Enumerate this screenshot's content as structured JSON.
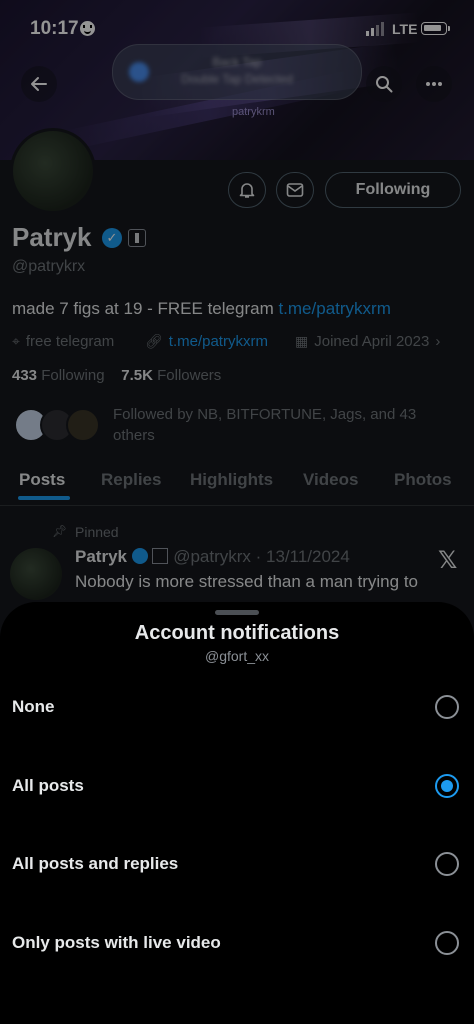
{
  "status_bar": {
    "time": "10:17",
    "network": "LTE"
  },
  "top_bar": {
    "back_icon": "arrow-left-icon",
    "notification_pill": {
      "line1": "Back Tap",
      "line2": "Double Tap Detected"
    },
    "search_icon": "search-icon",
    "more_icon": "more-horizontal-icon"
  },
  "profile": {
    "banner_tag": "patrykrm",
    "name": "Patryk",
    "handle": "@patrykrx",
    "bio_text": "made 7 figs at 19 - FREE telegram ",
    "bio_link": "t.me/patrykxrm",
    "location": "free telegram",
    "website": "t.me/patrykxrm",
    "joined": "Joined April 2023",
    "following_count": "433",
    "following_label": "Following",
    "followers_count": "7.5K",
    "followers_label": "Followers",
    "followed_by": "Followed by NB, BITFORTUNE, Jags, and 43 others",
    "follow_button": "Following"
  },
  "tabs": [
    "Posts",
    "Replies",
    "Highlights",
    "Videos",
    "Photos"
  ],
  "pinned_post": {
    "pinned_label": "Pinned",
    "author": "Patryk",
    "meta": "@patrykrx · 13/11/2024",
    "text": "Nobody is more stressed than a man trying to"
  },
  "sheet": {
    "title": "Account notifications",
    "subtitle": "@gfort_xx",
    "options": [
      {
        "label": "None",
        "selected": false
      },
      {
        "label": "All posts",
        "selected": true
      },
      {
        "label": "All posts and replies",
        "selected": false
      },
      {
        "label": "Only posts with live video",
        "selected": false
      }
    ]
  },
  "colors": {
    "accent": "#1d9bf0",
    "background": "#000000",
    "text": "#e7e9ea",
    "muted": "#71767b"
  }
}
